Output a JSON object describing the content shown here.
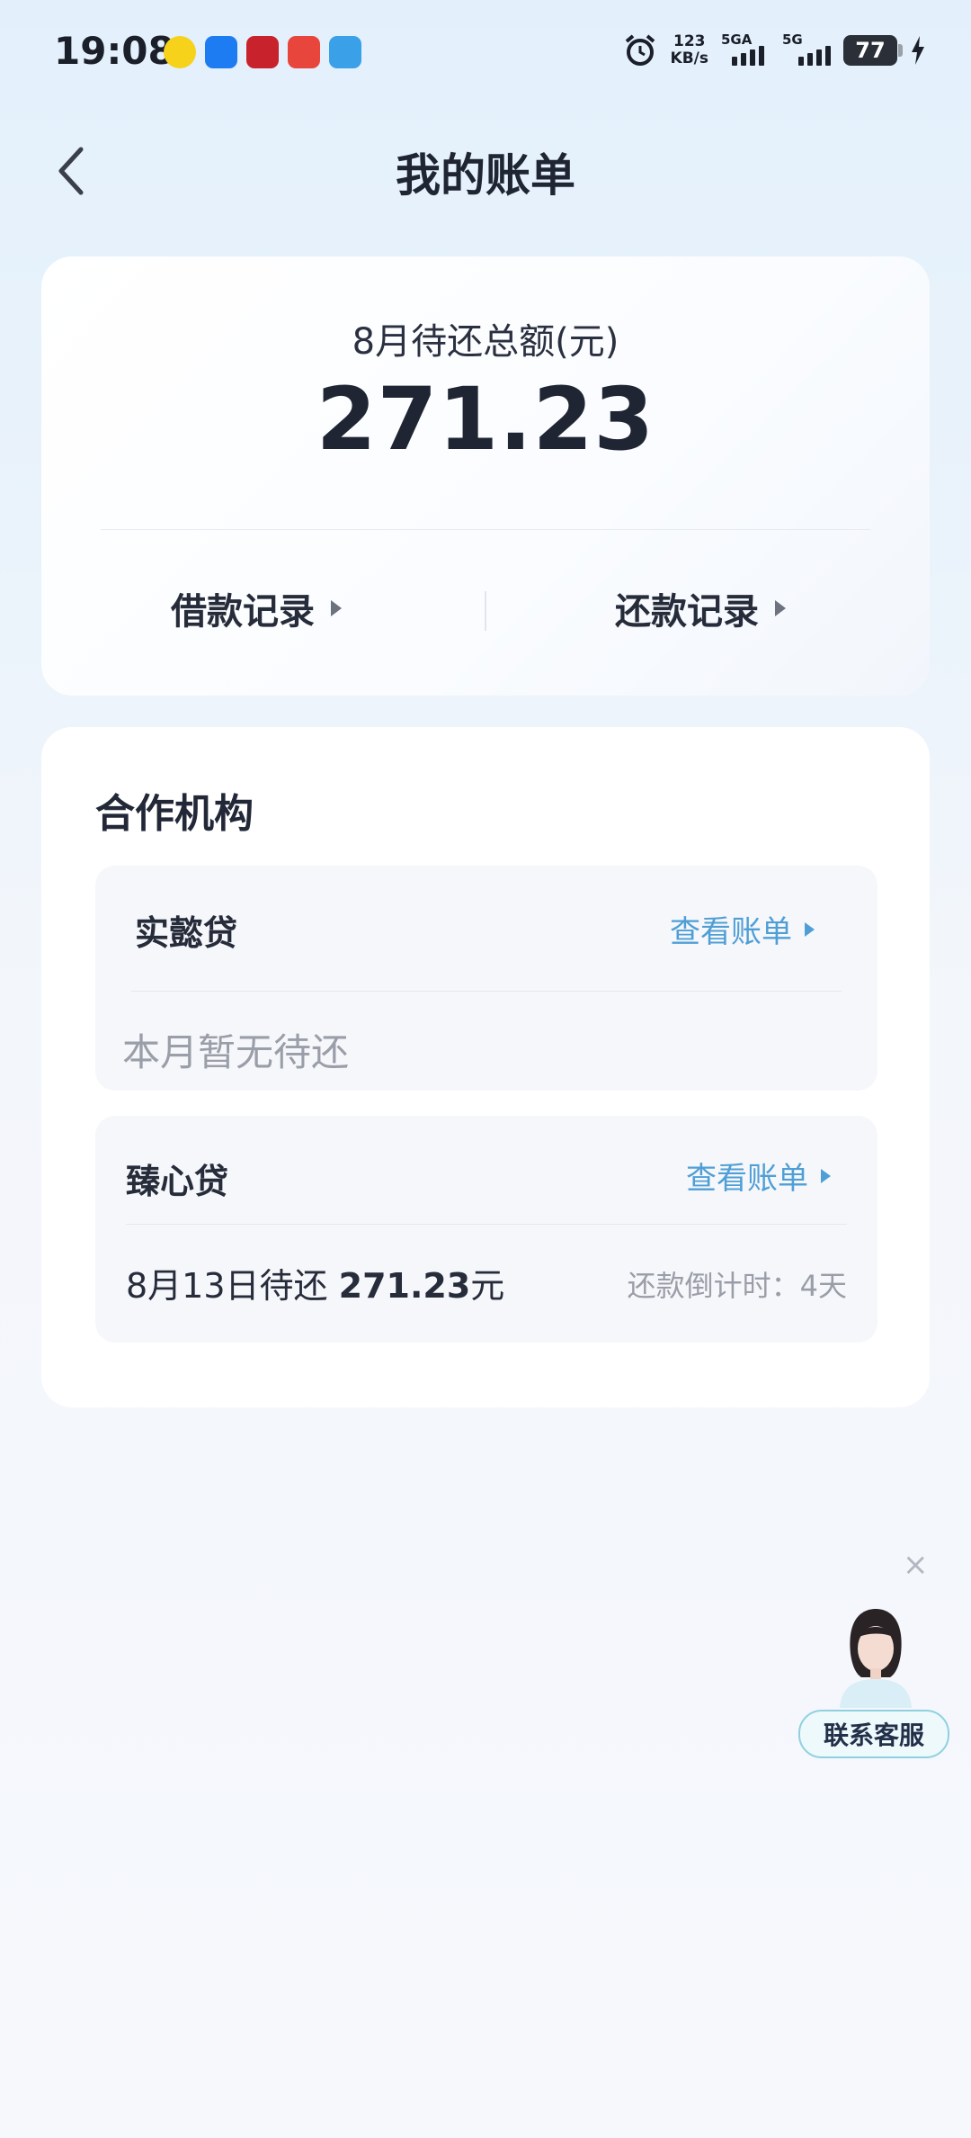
{
  "status_bar": {
    "time": "19:08",
    "net_speed_value": "123",
    "net_speed_unit": "KB/s",
    "sim1_label": "5GA",
    "sim2_label": "5G",
    "battery": "77"
  },
  "header": {
    "title": "我的账单"
  },
  "summary": {
    "label": "8月待还总额(元)",
    "amount": "271.23",
    "borrow_records": "借款记录",
    "repay_records": "还款记录"
  },
  "partners": {
    "title": "合作机构",
    "items": [
      {
        "name": "实懿贷",
        "view_bill": "查看账单",
        "status": "本月暂无待还"
      },
      {
        "name": "臻心贷",
        "view_bill": "查看账单",
        "due_prefix": "8月13日待还",
        "due_amount": "271.23",
        "due_unit": "元",
        "countdown": "还款倒计时：4天"
      }
    ]
  },
  "customer_service": {
    "label": "联系客服",
    "close": "×"
  }
}
